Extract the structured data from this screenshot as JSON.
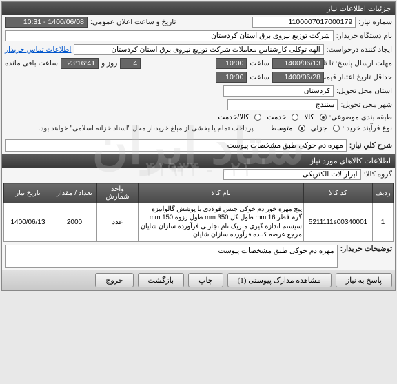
{
  "header": {
    "title": "جزئیات اطلاعات نیاز"
  },
  "fields": {
    "need_number_label": "شماره نیاز:",
    "need_number": "1100007017000179",
    "announce_label": "تاریخ و ساعت اعلان عمومی:",
    "announce_value": "1400/06/08 - 10:31",
    "buyer_org_label": "نام دستگاه خریدار:",
    "buyer_org": "شرکت توزیع نیروی برق استان کردستان",
    "requester_label": "ایجاد کننده درخواست:",
    "requester": "الهه توکلی کارشناس معاملات شرکت توزیع نیروی برق استان کردستان",
    "contact_link": "اطلاعات تماس خریدار",
    "deadline_label": "مهلت ارسال پاسخ: تا تاریخ:",
    "deadline_date": "1400/06/13",
    "time_label": "ساعت",
    "deadline_time": "10:00",
    "remaining_days": "4",
    "day_and_label": "روز و",
    "remaining_time": "23:16:41",
    "remaining_suffix": "ساعت باقی مانده",
    "validity_label": "حداقل تاریخ اعتبار قیمت: تا تاریخ:",
    "validity_date": "1400/06/28",
    "validity_time": "10:00",
    "province_label": "استان محل تحویل:",
    "province": "کردستان",
    "city_label": "شهر محل تحویل:",
    "city": "سنندج",
    "category_label": "طبقه بندی موضوعی:",
    "cat_goods": "کالا",
    "cat_service": "خدمت",
    "cat_both": "کالا/خدمت",
    "purchase_type_label": "نوع فرآیند خرید :",
    "pt_small": "جزئی",
    "pt_medium": "متوسط",
    "pt_note": "پرداخت تمام یا بخشی از مبلغ خرید،از محل \"اسناد خزانه اسلامی\" خواهد بود.",
    "desc_label": "شرح کلي نیاز:",
    "desc_value": "مهره دم خوکی طبق مشخصات پیوست"
  },
  "items_header": "اطلاعات کالاهای مورد نیاز",
  "group_label": "گروه کالا:",
  "group_value": "ابزارآلات الکتریکی",
  "table": {
    "headers": [
      "ردیف",
      "کد کالا",
      "نام کالا",
      "واحد شمارش",
      "تعداد / مقدار",
      "تاریخ نیاز"
    ],
    "rows": [
      {
        "idx": "1",
        "code": "5211111s00340001",
        "name": "پیچ مهره خور دم خوکی جنس فولادی با پوشش گالوانیزه گرم قطر mm 16 طول کل mm 350 طول رزوه mm 150 سیستم اندازه گیری متریک نام تجارتی فرآورده سازان شایان مرجع عرضه کننده فرآورده سازان شایان",
        "unit": "عدد",
        "qty": "2000",
        "date": "1400/06/13"
      }
    ]
  },
  "buyer_notes_label": "توضیحات خریدار:",
  "buyer_notes": "مهره دم خوکی طبق مشخصات پیوست",
  "footer": {
    "reply": "پاسخ به نیاز",
    "attachments": "مشاهده مدارک پیوستی (1)",
    "print": "چاپ",
    "back": "بازگشت",
    "exit": "خروج"
  },
  "watermark_big": "ستاد ایران",
  "watermark_small": "۰۲۱ - ۴۱۹۳۴"
}
